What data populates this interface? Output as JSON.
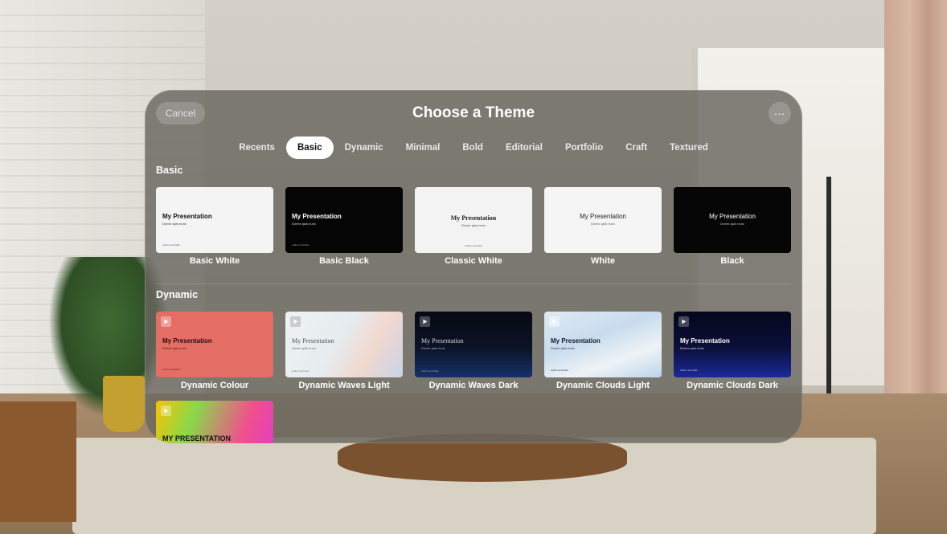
{
  "header": {
    "cancel_label": "Cancel",
    "title": "Choose a Theme",
    "more_icon": "ellipsis-icon"
  },
  "tabs": [
    {
      "label": "Recents",
      "active": false
    },
    {
      "label": "Basic",
      "active": true
    },
    {
      "label": "Dynamic",
      "active": false
    },
    {
      "label": "Minimal",
      "active": false
    },
    {
      "label": "Bold",
      "active": false
    },
    {
      "label": "Editorial",
      "active": false
    },
    {
      "label": "Portfolio",
      "active": false
    },
    {
      "label": "Craft",
      "active": false
    },
    {
      "label": "Textured",
      "active": false
    }
  ],
  "sections": {
    "basic": {
      "title": "Basic",
      "themes": [
        {
          "label": "Basic White",
          "preview_title": "My Presentation",
          "preview_subtitle": "Donec quis nunc",
          "preview_author": "Author and Date"
        },
        {
          "label": "Basic Black",
          "preview_title": "My Presentation",
          "preview_subtitle": "Donec quis nunc",
          "preview_author": "Author and Date"
        },
        {
          "label": "Classic White",
          "preview_title": "My Presentation",
          "preview_subtitle": "Donec quis nunc",
          "preview_author": "Author and Date"
        },
        {
          "label": "White",
          "preview_title": "My Presentation",
          "preview_subtitle": "Donec quis nunc"
        },
        {
          "label": "Black",
          "preview_title": "My Presentation",
          "preview_subtitle": "Donec quis nunc"
        }
      ]
    },
    "dynamic": {
      "title": "Dynamic",
      "themes": [
        {
          "label": "Dynamic Colour",
          "preview_title": "My Presentation",
          "preview_subtitle": "Donec quis nunc",
          "preview_author": "Author and Date"
        },
        {
          "label": "Dynamic Waves Light",
          "preview_title": "My Presentation",
          "preview_subtitle": "Donec quis nunc",
          "preview_author": "Author and Date"
        },
        {
          "label": "Dynamic Waves Dark",
          "preview_title": "My Presentation",
          "preview_subtitle": "Donec quis nunc",
          "preview_author": "Author and Date"
        },
        {
          "label": "Dynamic Clouds Light",
          "preview_title": "My Presentation",
          "preview_subtitle": "Donec quis nunc",
          "preview_author": "Author and Date"
        },
        {
          "label": "Dynamic Clouds Dark",
          "preview_title": "My Presentation",
          "preview_subtitle": "Donec quis nunc",
          "preview_author": "Author and Date"
        },
        {
          "label": "",
          "preview_title": "MY PRESENTATION"
        }
      ]
    }
  },
  "colors": {
    "accent_active_tab": "#ffffff",
    "dynamic_colour": "#e46d66",
    "waves_dark": "#0b1326",
    "clouds_dark": "#0b0f3a"
  }
}
